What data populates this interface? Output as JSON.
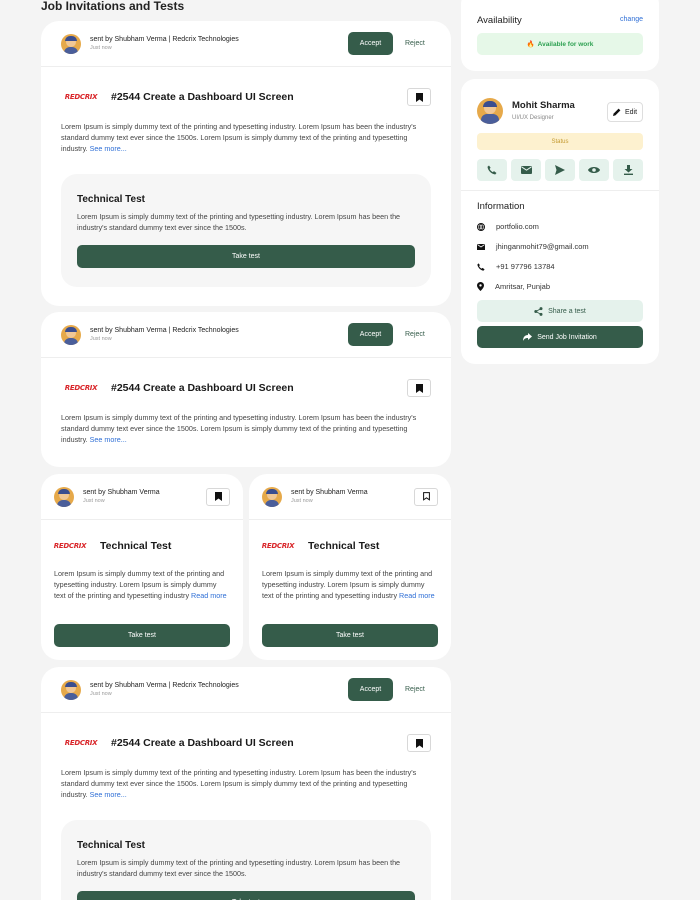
{
  "page": {
    "title": "Job Invitations and Tests"
  },
  "sender": {
    "full_name": "sent by Shubham Verma | Redcrix Technologies",
    "short_name": "sent by Shubham Verma",
    "time": "Just now"
  },
  "actions": {
    "accept": "Accept",
    "reject": "Reject",
    "take_test": "Take test"
  },
  "company": {
    "logo_text": "REDCRIX"
  },
  "job": {
    "title": "#2544 Create a Dashboard UI Screen",
    "description": "Lorem Ipsum is simply dummy text of the printing and typesetting industry. Lorem Ipsum has been the industry's standard dummy text ever since the 1500s. Lorem Ipsum is simply dummy text of the printing and typesetting industry.",
    "see_more": "See more..."
  },
  "technical_test": {
    "title": "Technical Test",
    "description": "Lorem Ipsum is simply dummy text of the printing and typesetting industry. Lorem Ipsum has been the industry's standard dummy text ever since the 1500s."
  },
  "small_test": {
    "title": "Technical Test",
    "description": "Lorem Ipsum is simply dummy text of the printing and typesetting industry. Lorem Ipsum is simply dummy text of the printing and typesetting industry",
    "read_more": "Read more"
  },
  "availability": {
    "label": "Availability",
    "change": "change",
    "status": "Available for work"
  },
  "profile": {
    "name": "Mohit Sharma",
    "role": "UI/UX Designer",
    "edit": "Edit",
    "status": "Status",
    "information_label": "Information",
    "website": "portfolio.com",
    "email": "jhinganmohit79@gmail.com",
    "phone": "+91 97796 13784",
    "location": "Amritsar, Punjab",
    "share_test": "Share a test",
    "send_invitation": "Send Job Invitation"
  },
  "colors": {
    "primary": "#355c4a",
    "accent_light": "#e5f2ec",
    "link": "#2f6fd6",
    "available_green": "#2ea152",
    "status_yellow": "#fdf1cf",
    "brand_red": "#d9262a"
  }
}
